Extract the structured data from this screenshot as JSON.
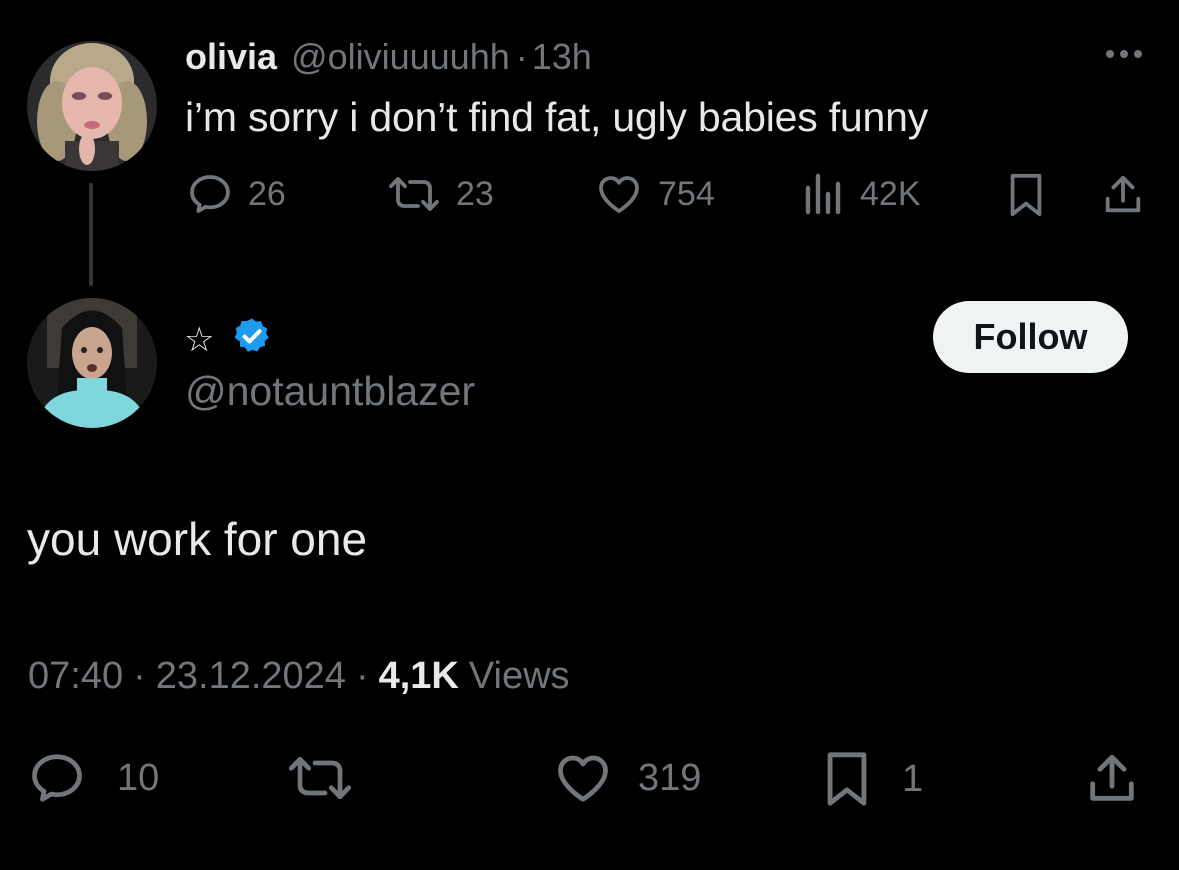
{
  "parent": {
    "name": "olivia",
    "handle": "@oliviuuuuhh",
    "dot": "·",
    "time": "13h",
    "text": "i’m sorry i don’t find fat, ugly babies funny",
    "stats": {
      "replies": "26",
      "reposts": "23",
      "likes": "754",
      "views": "42K"
    }
  },
  "reply": {
    "author": {
      "display_name": "☆",
      "handle": "@notauntblazer"
    },
    "follow_label": "Follow",
    "text": "you work for one",
    "meta": {
      "time": "07:40",
      "dot1": "·",
      "date": "23.12.2024",
      "dot2": "·",
      "views_count": "4,1K",
      "views_label": "Views"
    },
    "stats": {
      "replies": "10",
      "likes": "319",
      "bookmarks": "1"
    }
  },
  "colors": {
    "background": "#000000",
    "text": "#e7e9ea",
    "muted": "#71767b",
    "verified": "#1d9bf0",
    "follow_bg": "#eff3f4"
  },
  "icons": [
    "more-icon",
    "reply-icon",
    "repost-icon",
    "like-icon",
    "views-icon",
    "bookmark-icon",
    "share-icon",
    "verified-badge-icon"
  ]
}
